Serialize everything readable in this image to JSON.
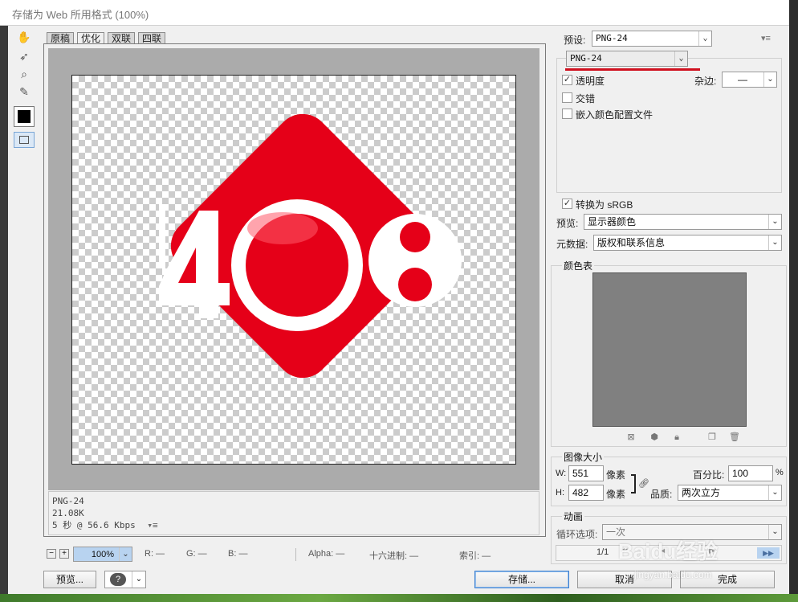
{
  "window": {
    "title": "存储为 Web 所用格式 (100%)"
  },
  "tabs": [
    {
      "label": "原稿"
    },
    {
      "label": "优化"
    },
    {
      "label": "双联"
    },
    {
      "label": "四联"
    }
  ],
  "preview": {
    "image_text": "408",
    "info_lines": [
      "PNG-24",
      "21.08K",
      "5 秒 @ 56.6 Kbps"
    ]
  },
  "bottom": {
    "zoom": "100%",
    "r": "R: —",
    "g": "G: —",
    "b": "B: —",
    "alpha": "Alpha: —",
    "hex": "十六进制: —",
    "index": "索引: —",
    "preview_btn": "预览...",
    "save_btn": "存储...",
    "cancel_btn": "取消",
    "done_btn": "完成"
  },
  "settings": {
    "preset_label": "预设:",
    "preset_value": "PNG-24",
    "format_value": "PNG-24",
    "transparency_label": "透明度",
    "matte_label": "杂边:",
    "matte_value": "—",
    "interlaced_label": "交错",
    "embed_profile_label": "嵌入颜色配置文件",
    "convert_srgb_label": "转换为 sRGB",
    "preview_label": "预览:",
    "preview_value": "显示器颜色",
    "metadata_label": "元数据:",
    "metadata_value": "版权和联系信息"
  },
  "color_table": {
    "title": "颜色表"
  },
  "image_size": {
    "title": "图像大小",
    "w_label": "W:",
    "w_value": "551",
    "h_label": "H:",
    "h_value": "482",
    "unit": "像素",
    "percent_label": "百分比:",
    "percent_value": "100",
    "percent_unit": "%",
    "quality_label": "品质:",
    "quality_value": "两次立方"
  },
  "animation": {
    "title": "动画",
    "loop_label": "循环选项:",
    "loop_value": "一次",
    "frame_counter": "1/1"
  },
  "watermark": {
    "text": "Baidu经验",
    "url": "jingyan.baidu.com"
  },
  "colors": {
    "logo_red": "#e50018",
    "accent_underline": "#d0101e"
  }
}
